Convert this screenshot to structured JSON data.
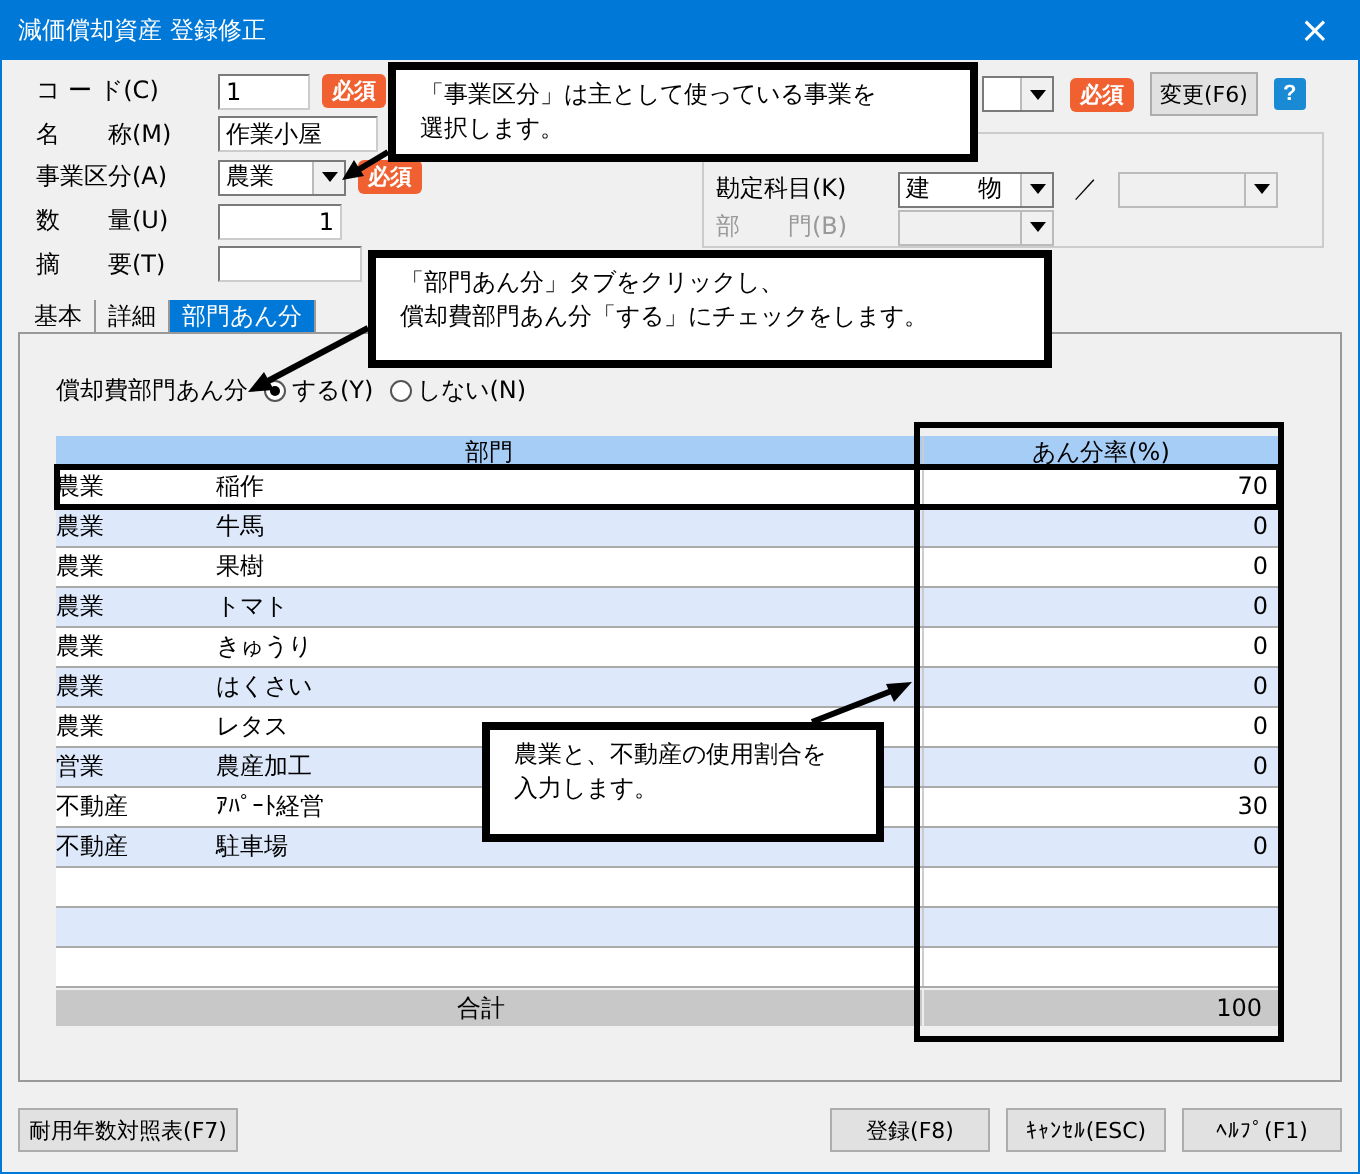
{
  "window": {
    "title": "減価償却資産 登録修正",
    "close": "×"
  },
  "form": {
    "fields": [
      {
        "label": "コ ー ド(C)",
        "kind": "input",
        "value": "1",
        "required": "必須"
      },
      {
        "label": "名　　称(M)",
        "kind": "input",
        "value": "作業小屋"
      },
      {
        "label": "事業区分(A)",
        "kind": "select",
        "value": "農業",
        "required": "必須"
      },
      {
        "label": "数　　量(U)",
        "kind": "number",
        "value": "1"
      },
      {
        "label": "摘　　要(T)",
        "kind": "input"
      }
    ],
    "right": {
      "required": "必須",
      "change_button": "変更(F6)",
      "help": "?",
      "account": {
        "label": "勘定科目(K)",
        "value": "建　　物",
        "separator": "／",
        "disabled": false
      },
      "department": {
        "label": "部　　門(B)",
        "disabled": true
      }
    }
  },
  "tabs": [
    {
      "label": "基本",
      "selected": false
    },
    {
      "label": "詳細",
      "selected": false
    },
    {
      "label": "部門あん分",
      "selected": true
    }
  ],
  "allocation": {
    "label": "償却費部門あん分",
    "options": [
      {
        "label": "する(Y)",
        "selected": true
      },
      {
        "label": "しない(N)",
        "selected": false
      }
    ]
  },
  "table": {
    "columns": [
      "部門",
      "あん分率(%)"
    ],
    "rows": [
      {
        "category": "農業",
        "name": "稲作",
        "rate": "70"
      },
      {
        "category": "農業",
        "name": "牛馬",
        "rate": "0"
      },
      {
        "category": "農業",
        "name": "果樹",
        "rate": "0"
      },
      {
        "category": "農業",
        "name": "トマト",
        "rate": "0"
      },
      {
        "category": "農業",
        "name": "きゅうり",
        "rate": "0"
      },
      {
        "category": "農業",
        "name": "はくさい",
        "rate": "0"
      },
      {
        "category": "農業",
        "name": "レタス",
        "rate": "0"
      },
      {
        "category": "営業",
        "name": "農産加工",
        "rate": "0"
      },
      {
        "category": "不動産",
        "name": "ｱﾊﾟｰﾄ経営",
        "rate": "30"
      },
      {
        "category": "不動産",
        "name": "駐車場",
        "rate": "0"
      }
    ],
    "total": {
      "label": "合計",
      "value": "100"
    }
  },
  "buttons": {
    "left": "耐用年数対照表(F7)",
    "right": [
      "登録(F8)",
      "ｷｬﾝｾﾙ(ESC)",
      "ﾍﾙﾌﾟ(F1)"
    ]
  },
  "callouts": [
    {
      "lines": [
        "「事業区分」は主として使っている事業を",
        "選択します。"
      ]
    },
    {
      "lines": [
        "「部門あん分」タブをクリックし、",
        "償却費部門あん分「する」にチェックをします。"
      ]
    },
    {
      "lines": [
        "農業と、不動産の使用割合を",
        "入力します。"
      ]
    }
  ]
}
